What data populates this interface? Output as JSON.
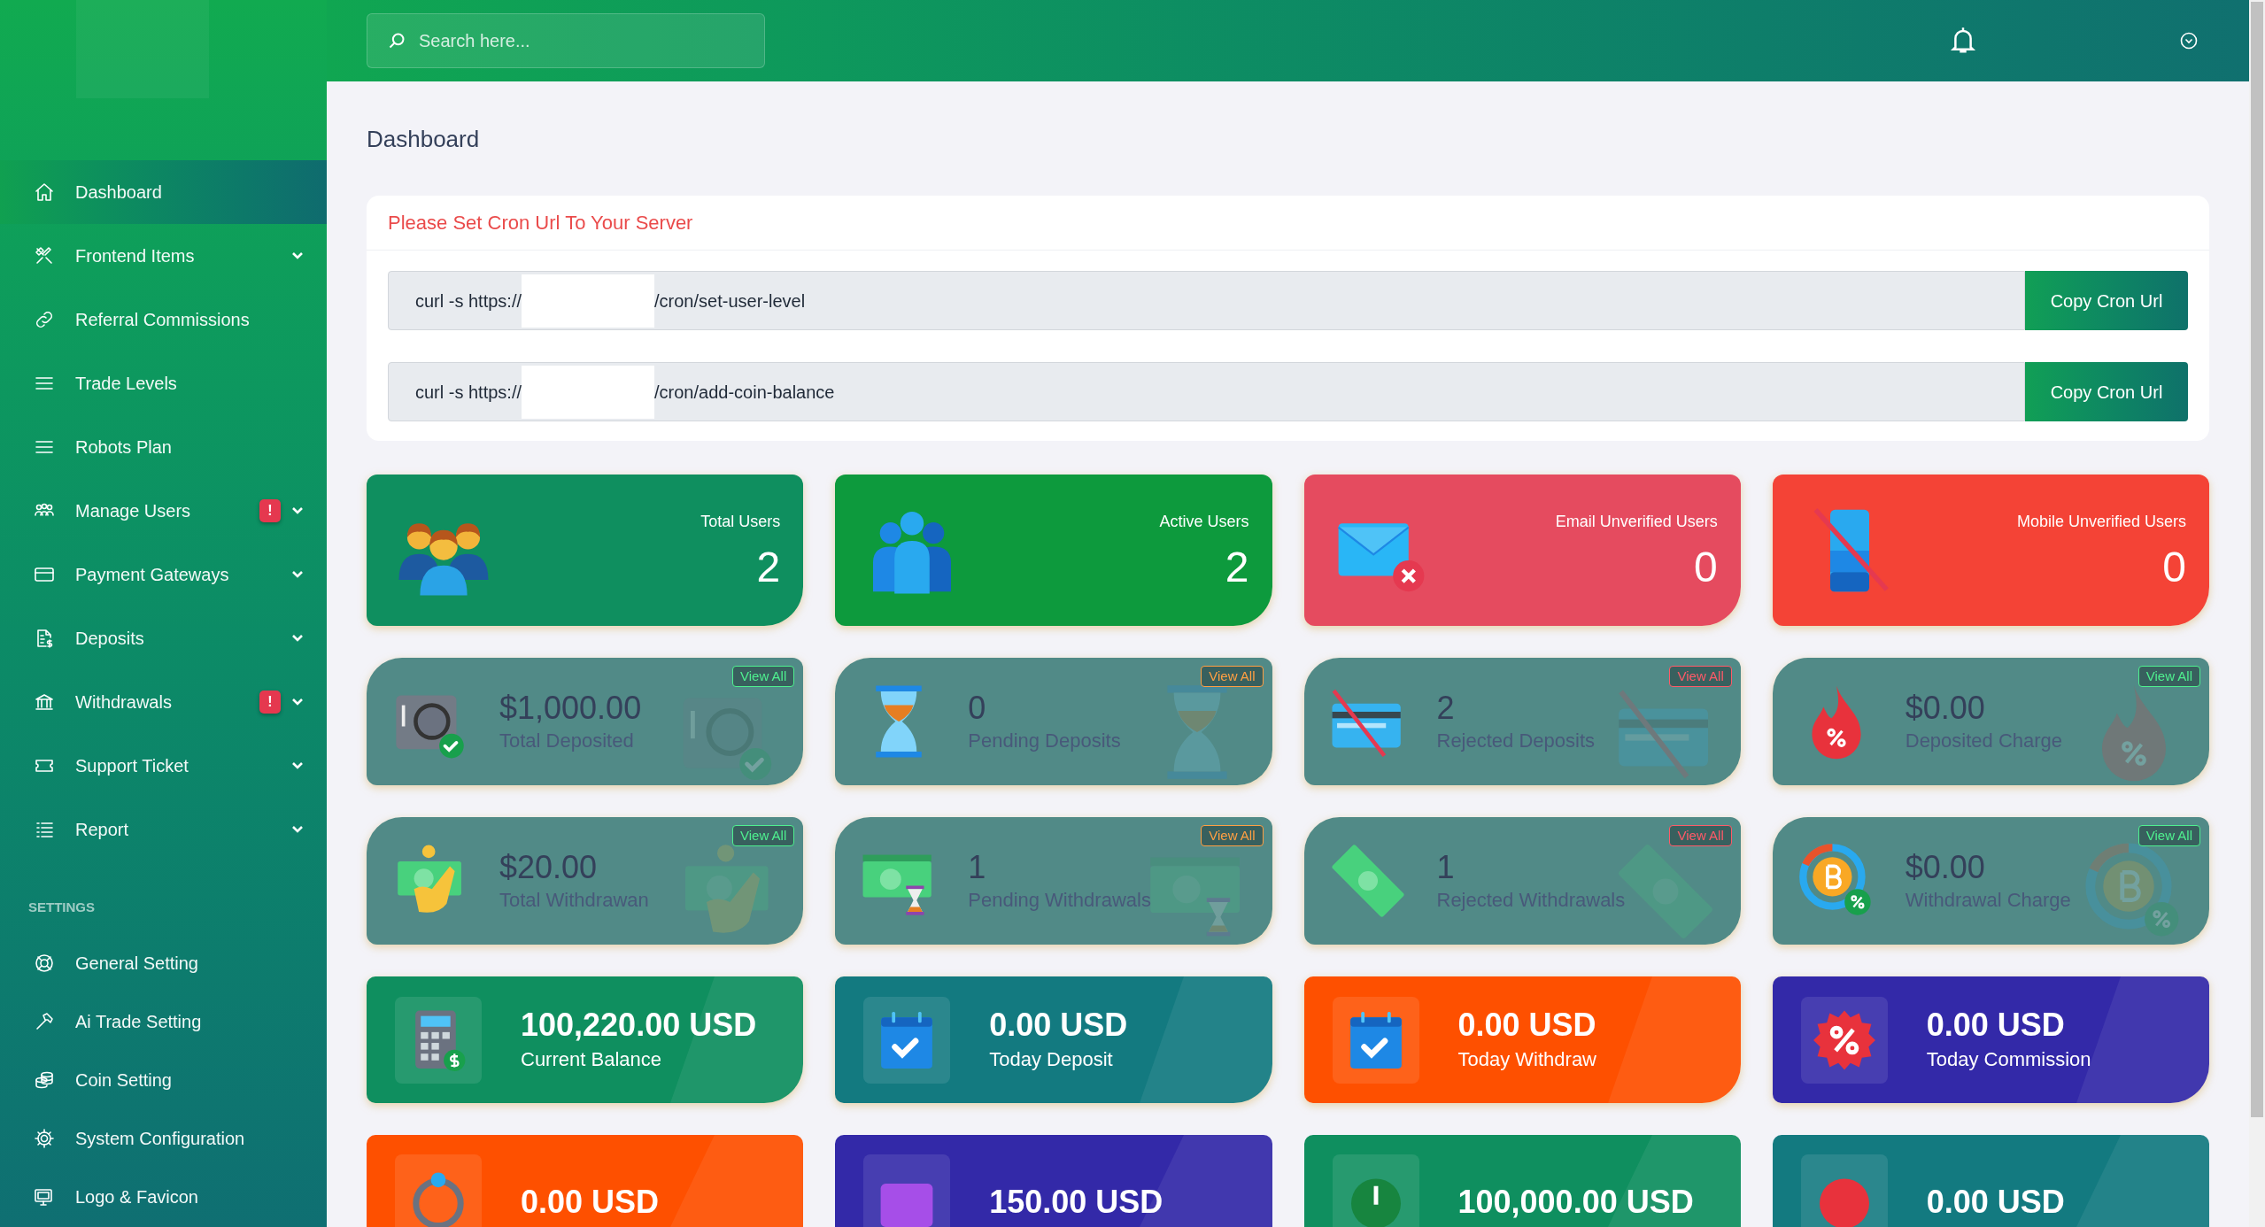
{
  "sidebar": {
    "items": [
      {
        "label": "Dashboard",
        "selected": true,
        "expandable": false
      },
      {
        "label": "Frontend Items",
        "selected": false,
        "expandable": true
      },
      {
        "label": "Referral Commissions",
        "selected": false,
        "expandable": false
      },
      {
        "label": "Trade Levels",
        "selected": false,
        "expandable": false
      },
      {
        "label": "Robots Plan",
        "selected": false,
        "expandable": false
      },
      {
        "label": "Manage Users",
        "selected": false,
        "expandable": true,
        "badge": "!"
      },
      {
        "label": "Payment Gateways",
        "selected": false,
        "expandable": true
      },
      {
        "label": "Deposits",
        "selected": false,
        "expandable": true
      },
      {
        "label": "Withdrawals",
        "selected": false,
        "expandable": true,
        "badge": "!"
      },
      {
        "label": "Support Ticket",
        "selected": false,
        "expandable": true
      },
      {
        "label": "Report",
        "selected": false,
        "expandable": true
      }
    ],
    "section_title": "SETTINGS",
    "settings_items": [
      {
        "label": "General Setting",
        "selected": false
      },
      {
        "label": "Ai Trade Setting",
        "selected": false
      },
      {
        "label": "Coin Setting",
        "selected": false
      },
      {
        "label": "System Configuration",
        "selected": false
      },
      {
        "label": "Logo & Favicon",
        "selected": false
      }
    ]
  },
  "topbar": {
    "search": {
      "placeholder": "Search here..."
    }
  },
  "page_title": "Dashboard",
  "cron": {
    "title": "Please Set Cron Url To Your Server",
    "rows": [
      {
        "url_start": "curl -s https://",
        "url_end": "/cron/set-user-level",
        "button": "Copy Cron Url"
      },
      {
        "url_start": "curl -s https://",
        "url_end": "/cron/add-coin-balance",
        "button": "Copy Cron Url"
      }
    ]
  },
  "user_cards": [
    {
      "label": "Total Users",
      "value": "2",
      "color": "#0f8f5f"
    },
    {
      "label": "Active Users",
      "value": "2",
      "color": "#0d9a3d"
    },
    {
      "label": "Email Unverified Users",
      "value": "0",
      "color": "#e54b5f"
    },
    {
      "label": "Mobile Unverified Users",
      "value": "0",
      "color": "#f44336"
    }
  ],
  "transaction_cards": [
    {
      "value": "$1,000.00",
      "label": "Total Deposited",
      "link": "View All",
      "color": "#4ff08f"
    },
    {
      "value": "0",
      "label": "Pending Deposits",
      "link": "View All",
      "color": "#ff9f43"
    },
    {
      "value": "2",
      "label": "Rejected Deposits",
      "link": "View All",
      "color": "#ff5a68"
    },
    {
      "value": "$0.00",
      "label": "Deposited Charge",
      "link": "View All",
      "color": "#4ff08f"
    },
    {
      "value": "$20.00",
      "label": "Total Withdrawan",
      "link": "View All",
      "color": "#4ff08f"
    },
    {
      "value": "1",
      "label": "Pending Withdrawals",
      "link": "View All",
      "color": "#ff9f43"
    },
    {
      "value": "1",
      "label": "Rejected Withdrawals",
      "link": "View All",
      "color": "#ff5a68"
    },
    {
      "value": "$0.00",
      "label": "Withdrawal Charge",
      "link": "View All",
      "color": "#4ff08f"
    }
  ],
  "balance_cards": [
    {
      "value": "100,220.00 USD",
      "label": "Current Balance",
      "color": "#0f8f5f"
    },
    {
      "value": "0.00 USD",
      "label": "Today Deposit",
      "color": "#137a80"
    },
    {
      "value": "0.00 USD",
      "label": "Today Withdraw",
      "color": "#fe5000"
    },
    {
      "value": "0.00 USD",
      "label": "Today Commission",
      "color": "#3329a8"
    },
    {
      "value": "0.00 USD",
      "color": "#fe5000"
    },
    {
      "value": "150.00 USD",
      "color": "#3329a8"
    },
    {
      "value": "100,000.00 USD",
      "color": "#0f8f5f"
    },
    {
      "value": "0.00 USD",
      "color": "#137a80"
    }
  ]
}
